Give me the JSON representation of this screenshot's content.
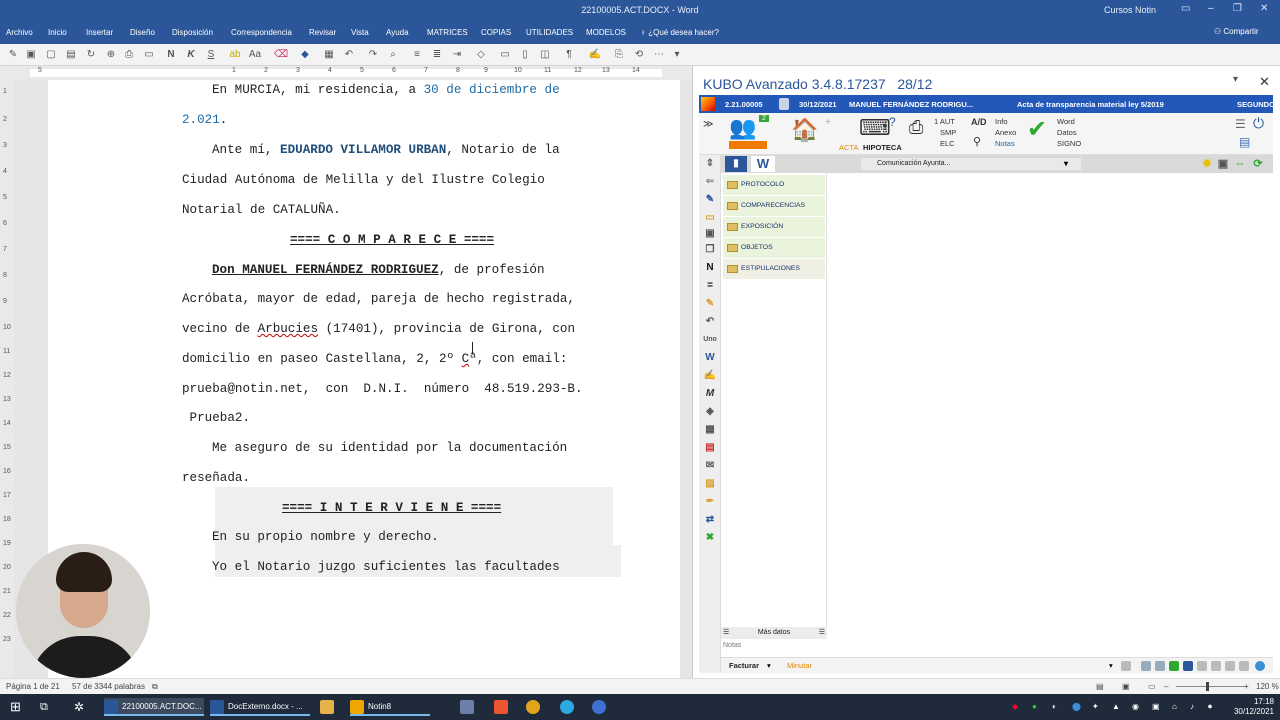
{
  "word": {
    "doc_title": "22100005.ACT.DOCX - Word",
    "user": "Cursos Notin",
    "tabs": [
      "Archivo",
      "Inicio",
      "Insertar",
      "Diseño",
      "Disposición",
      "Correspondencia",
      "Revisar",
      "Vista",
      "Ayuda",
      "MATRICES",
      "COPIAS",
      "UTILIDADES",
      "MODELOS",
      "¿Qué desea hacer?"
    ],
    "share": "Compartir",
    "ruler_h": [
      "5",
      "1",
      "2",
      "3",
      "4",
      "5",
      "6",
      "7",
      "8",
      "9",
      "10",
      "11",
      "12",
      "13",
      "14",
      "15"
    ],
    "ruler_v": [
      "1",
      "2",
      "3",
      "4",
      "5",
      "6",
      "7",
      "8",
      "9",
      "10",
      "11",
      "12",
      "13",
      "14",
      "15",
      "16",
      "17",
      "18",
      "19",
      "20",
      "21",
      "22",
      "23"
    ]
  },
  "document": {
    "l1a": "En MURCIA, mi residencia, a ",
    "l1date": "30 de diciembre de",
    "l2": "2.021",
    "l2b": ".",
    "l3a": "Ante mí, ",
    "l3name": "EDUARDO VILLAMOR URBAN",
    "l3b": ", Notario de la",
    "l4": "Ciudad Autónoma de Melilla y del Ilustre Colegio",
    "l5": "Notarial de CATALUÑA.",
    "comparece": "==== C O M P A R E C E ====",
    "l7name": "Don MANUEL FERNÁNDEZ RODRIGUEZ",
    "l7b": ", de profesión",
    "l8": "Acróbata, mayor de edad, pareja de hecho registrada,",
    "l9a": "vecino de ",
    "l9town": "Arbucies",
    "l9b": " (17401), provincia de Girona, con",
    "l10a": "domicilio en paseo Castellana, 2, 2º ",
    "l10c": "C",
    "l10b": "ª, con email:",
    "l11": "prueba@notin.net,  con  D.N.I.  número  48.519.293-B.",
    "l12": " Prueba2.",
    "l13": "Me aseguro de su identidad por la documentación",
    "l14": "reseñada.",
    "interviene": "==== I N T E R V I E N E ====",
    "l16": "En su propio nombre y derecho.",
    "l17": "Yo el Notario juzgo suficientes las facultades"
  },
  "status": {
    "page": "Página 1 de 21",
    "words": "57 de 3344 palabras",
    "zoom": "120 %"
  },
  "taskbar": {
    "items": [
      "22100005.ACT.DOC...",
      "DocExterno.docx - ...",
      "Notin8"
    ],
    "time": "17:18",
    "date": "30/12/2021"
  },
  "kubo": {
    "title": "KUBO Avanzado 3.4.8.17237",
    "title_page": "28/12",
    "header": {
      "number": "2.21.00005",
      "date": "30/12/2021",
      "client": "MANUEL FERNÁNDEZ RODRIGU...",
      "act": "Acta de transparencia material ley 5/2019",
      "copy": "SEGUNDO"
    },
    "toolbar": {
      "badge": "2",
      "acta": "ACTA",
      "hipoteca": "HIPOTECA",
      "aut": "1 AUT",
      "smp": "SMP",
      "elc": "ELC",
      "info": "Info",
      "anexo": "Anexo",
      "notas": "Notas",
      "word": "Word",
      "datos": "Datos",
      "signo": "SIGNO"
    },
    "combo": "Comunicación Ayunta...",
    "tree": [
      "PROTOCOLO",
      "COMPARECENCIAS",
      "EXPOSICIÓN",
      "OBJETOS",
      "ESTIPULACIONES"
    ],
    "more": "Más datos",
    "notes": "Notas",
    "facturar": "Facturar",
    "minutar": "Minutar"
  },
  "colors": {
    "word_blue": "#2b579a",
    "kubo_header": "#2358b8",
    "tree_bg": "#eaf3dc"
  }
}
